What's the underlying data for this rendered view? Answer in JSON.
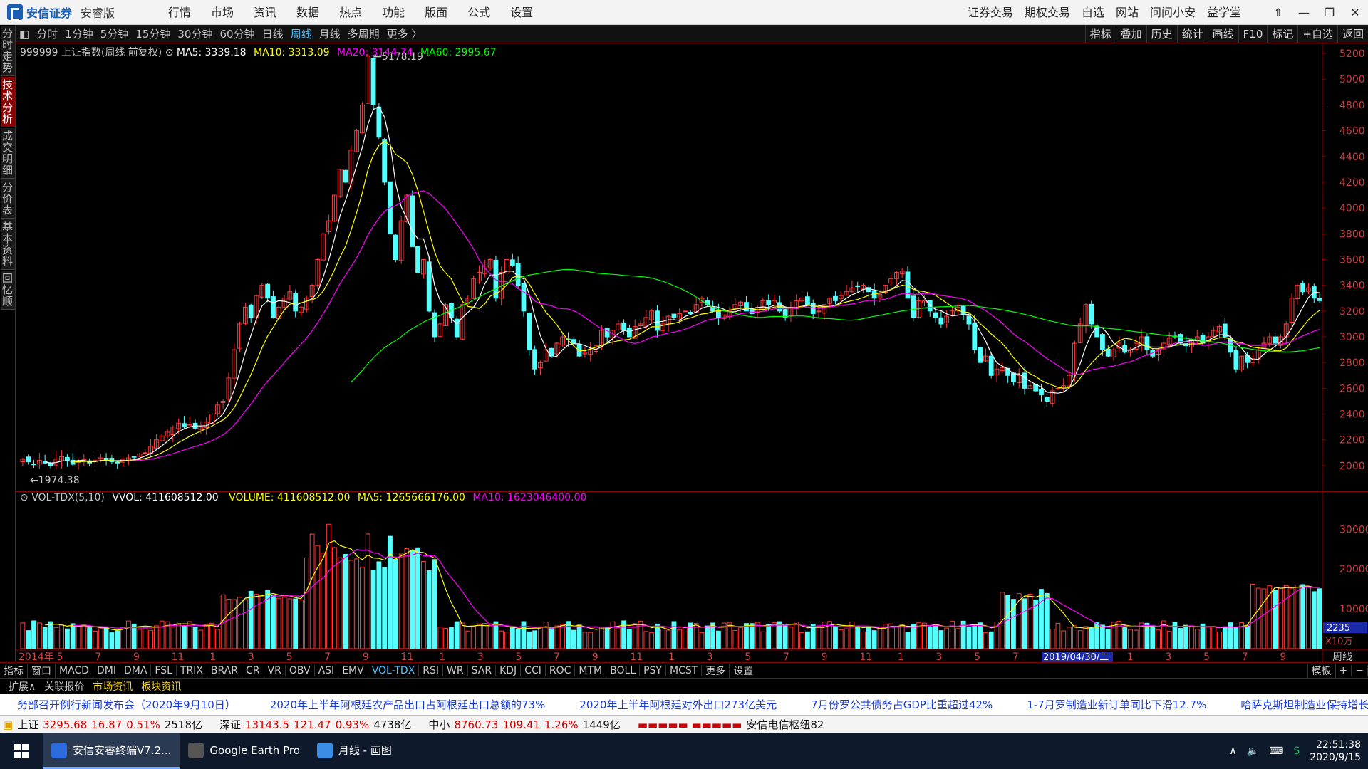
{
  "app": {
    "logo": "安信证券",
    "edition": "安睿版"
  },
  "menu": [
    "行情",
    "市场",
    "资讯",
    "数据",
    "热点",
    "功能",
    "版面",
    "公式",
    "设置"
  ],
  "right_menu": [
    "证券交易",
    "期权交易",
    "自选",
    "网站",
    "问问小安",
    "益学堂"
  ],
  "window_buttons": [
    "⇑",
    "—",
    "❐",
    "✕"
  ],
  "side_tabs": [
    "分时走势",
    "技术分析",
    "成交明细",
    "分价表",
    "基本资料",
    "回忆顺"
  ],
  "side_active": 1,
  "periods": [
    "分时",
    "1分钟",
    "5分钟",
    "15分钟",
    "30分钟",
    "60分钟",
    "日线",
    "周线",
    "月线",
    "多周期",
    "更多 〉"
  ],
  "period_active": 7,
  "right_tools": [
    "指标",
    "叠加",
    "历史",
    "统计",
    "画线",
    "F10",
    "标记",
    "+自选",
    "返回"
  ],
  "main_info": {
    "code": "999999 上证指数(周线 前复权)",
    "ma5": "MA5: 3339.18",
    "ma10": "MA10: 3313.09",
    "ma20": "MA20: 3144.74",
    "ma60": "MA60: 2995.67"
  },
  "high_label": "5178.19",
  "low_label": "1974.38",
  "price_axis": [
    "5200",
    "5000",
    "4800",
    "4600",
    "4400",
    "4200",
    "4000",
    "3800",
    "3600",
    "3400",
    "3200",
    "3000",
    "2800",
    "2600",
    "2400",
    "2200",
    "2000"
  ],
  "vol_info": {
    "name": "VOL-TDX(5,10)",
    "vvol": "VVOL: 411608512.00",
    "volume": "VOLUME: 411608512.00",
    "ma5": "MA5: 1265666176.00",
    "ma10": "MA10: 1623046400.00"
  },
  "vol_axis": [
    "30000",
    "20000",
    "10000"
  ],
  "vol_current": "2235",
  "vol_unit": "X10万",
  "x_labels": [
    "2014年",
    "5",
    "7",
    "9",
    "11",
    "1",
    "3",
    "5",
    "7",
    "9",
    "11",
    "1",
    "3",
    "5",
    "7",
    "9",
    "11",
    "1",
    "3",
    "5",
    "7",
    "9",
    "11",
    "1",
    "3",
    "5",
    "7",
    "9",
    "11",
    "1",
    "3",
    "5",
    "7",
    "9"
  ],
  "x_highlight": "2019/04/30/二",
  "x_period": "周线",
  "indicators": [
    "指标",
    "窗口",
    "MACD",
    "DMI",
    "DMA",
    "FSL",
    "TRIX",
    "BRAR",
    "CR",
    "VR",
    "OBV",
    "ASI",
    "EMV",
    "VOL-TDX",
    "RSI",
    "WR",
    "SAR",
    "KDJ",
    "CCI",
    "ROC",
    "MTM",
    "BOLL",
    "PSY",
    "MCST",
    "更多",
    "设置"
  ],
  "indicator_active": "VOL-TDX",
  "template_label": "模板",
  "plus_minus": [
    "+",
    "−"
  ],
  "subtabs": [
    "扩展∧",
    "关联报价",
    "市场资讯",
    "板块资讯"
  ],
  "news": [
    "务部召开例行新闻发布会（2020年9月10日）",
    "2020年上半年阿根廷农产品出口占阿根廷出口总额的73%",
    "2020年上半年阿根廷对外出口273亿美元",
    "7月份罗公共债务占GDP比重超过42%",
    "1-7月罗制造业新订单同比下滑12.7%",
    "哈萨克斯坦制造业保持增长势头"
  ],
  "status": [
    {
      "name": "上证",
      "price": "3295.68",
      "chg": "16.87",
      "pct": "0.51%",
      "amt": "2518亿"
    },
    {
      "name": "深证",
      "price": "13143.5",
      "chg": "121.47",
      "pct": "0.93%",
      "amt": "4738亿"
    },
    {
      "name": "中小",
      "price": "8760.73",
      "chg": "109.41",
      "pct": "1.26%",
      "amt": "1449亿"
    }
  ],
  "server": "安信电信枢纽82",
  "taskbar": [
    {
      "label": "安信安睿终端V7.2..."
    },
    {
      "label": "Google Earth Pro"
    },
    {
      "label": "月线 - 画图"
    }
  ],
  "clock": {
    "time": "22:51:38",
    "date": "2020/9/15"
  },
  "colors": {
    "up": "#ff3c3c",
    "down": "#54ffff",
    "ma5": "#ffffff",
    "ma10": "#ffff00",
    "ma20": "#ff00ff",
    "ma60": "#00ff00"
  },
  "chart_data": {
    "type": "candlestick",
    "title": "999999 上证指数(周线 前复权)",
    "ylim": [
      1900,
      5250
    ],
    "closes": [
      2050,
      2030,
      2010,
      2040,
      2020,
      2000,
      2050,
      2070,
      2040,
      2010,
      2030,
      2050,
      2020,
      2040,
      2060,
      2040,
      2030,
      2020,
      2050,
      2060,
      2070,
      2090,
      2100,
      2150,
      2200,
      2230,
      2260,
      2300,
      2330,
      2300,
      2320,
      2290,
      2300,
      2340,
      2400,
      2470,
      2500,
      2680,
      2900,
      3100,
      3230,
      3150,
      3320,
      3400,
      3300,
      3150,
      3230,
      3300,
      3350,
      3200,
      3230,
      3300,
      3400,
      3600,
      3800,
      3900,
      4100,
      4300,
      4200,
      4450,
      4600,
      4800,
      5178,
      4800,
      4550,
      4200,
      3800,
      3600,
      3900,
      4100,
      3700,
      3500,
      3600,
      3200,
      3000,
      3100,
      3250,
      3150,
      3000,
      3250,
      3300,
      3450,
      3500,
      3550,
      3600,
      3300,
      3500,
      3600,
      3550,
      3400,
      3200,
      2900,
      2750,
      2800,
      2900,
      2850,
      2950,
      3000,
      2980,
      2950,
      2850,
      2880,
      2900,
      2930,
      3050,
      3000,
      3050,
      3100,
      3050,
      3000,
      3080,
      3100,
      3150,
      3200,
      3050,
      3100,
      3160,
      3150,
      3180,
      3200,
      3180,
      3250,
      3300,
      3250,
      3200,
      3150,
      3170,
      3200,
      3250,
      3270,
      3200,
      3180,
      3230,
      3280,
      3250,
      3280,
      3200,
      3150,
      3230,
      3280,
      3300,
      3250,
      3180,
      3200,
      3250,
      3300,
      3280,
      3320,
      3350,
      3380,
      3390,
      3400,
      3350,
      3300,
      3330,
      3400,
      3450,
      3500,
      3510,
      3300,
      3150,
      3280,
      3280,
      3200,
      3150,
      3100,
      3160,
      3200,
      3230,
      3180,
      3100,
      2900,
      2800,
      2850,
      2700,
      2750,
      2760,
      2700,
      2650,
      2700,
      2600,
      2620,
      2580,
      2550,
      2500,
      2580,
      2600,
      2620,
      2700,
      2950,
      3100,
      3250,
      3100,
      3000,
      2900,
      2850,
      2900,
      2950,
      2880,
      2900,
      2950,
      3000,
      2900,
      2850,
      2900,
      2950,
      2990,
      3000,
      2950,
      2930,
      2980,
      3000,
      2950,
      3000,
      3050,
      3080,
      3000,
      2880,
      2750,
      2850,
      2800,
      2830,
      2900,
      2950,
      3000,
      2950,
      3000,
      3100,
      3300,
      3400,
      3350,
      3380,
      3300,
      3280
    ]
  }
}
